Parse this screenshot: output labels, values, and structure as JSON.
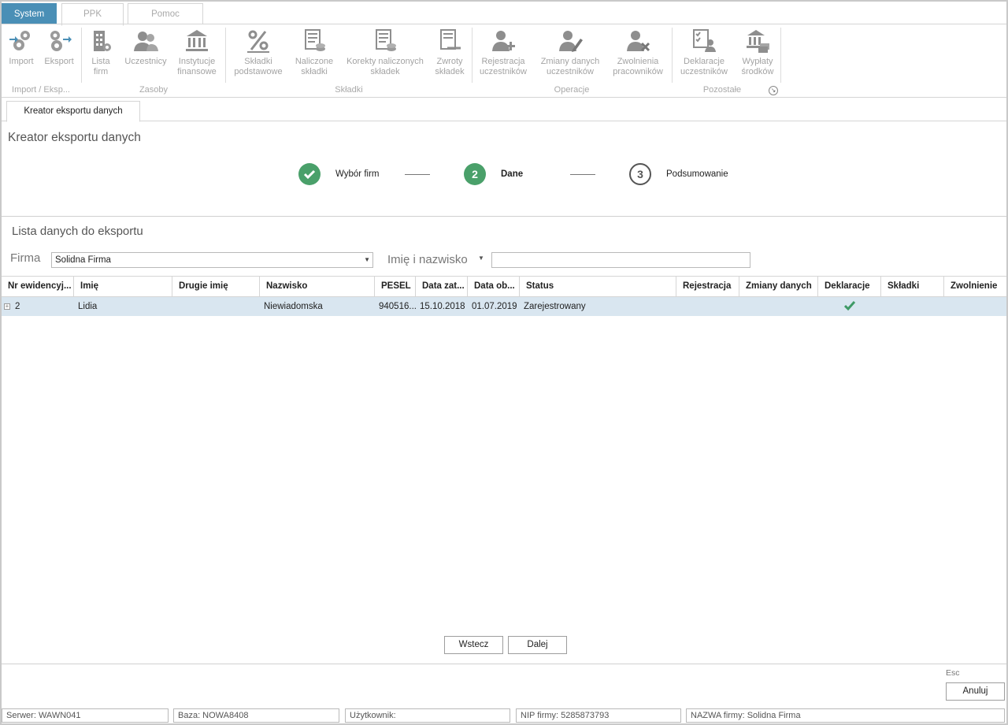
{
  "ribbon": {
    "tabs": [
      "System",
      "PPK",
      "Pomoc"
    ],
    "buttons": {
      "import": "Import",
      "eksport": "Eksport",
      "lista_firm": [
        "Lista",
        "firm"
      ],
      "uczestnicy": "Uczestnicy",
      "instytucje": [
        "Instytucje",
        "finansowe"
      ],
      "skladki_podstawowe": [
        "Składki",
        "podstawowe"
      ],
      "naliczone": [
        "Naliczone",
        "składki"
      ],
      "korekty": [
        "Korekty naliczonych",
        "składek"
      ],
      "zwroty": [
        "Zwroty",
        "składek"
      ],
      "rejestracja": [
        "Rejestracja",
        "uczestników"
      ],
      "zmiany": [
        "Zmiany danych",
        "uczestników"
      ],
      "zwolnienia": [
        "Zwolnienia",
        "pracowników"
      ],
      "deklaracje": [
        "Deklaracje",
        "uczestników"
      ],
      "wyplaty": [
        "Wypłaty",
        "środków"
      ]
    },
    "groups": {
      "import_eksport": "Import / Eksp...",
      "zasoby": "Zasoby",
      "skladki": "Składki",
      "operacje": "Operacje",
      "pozostale": "Pozostałe"
    }
  },
  "document_tab": "Kreator eksportu danych",
  "wizard": {
    "title": "Kreator eksportu danych",
    "steps": [
      {
        "number": "",
        "label": "Wybór firm",
        "state": "done"
      },
      {
        "number": "2",
        "label": "Dane",
        "state": "active"
      },
      {
        "number": "3",
        "label": "Podsumowanie",
        "state": "pending"
      }
    ]
  },
  "list": {
    "title": "Lista danych do eksportu",
    "firma_label": "Firma",
    "firma_value": "Solidna Firma",
    "name_filter_label": "Imię i nazwisko",
    "name_filter_value": ""
  },
  "grid": {
    "columns": [
      "Nr ewidencyj...",
      "Imię",
      "Drugie imię",
      "Nazwisko",
      "PESEL",
      "Data zat...",
      "Data ob...",
      "Status",
      "Rejestracja",
      "Zmiany danych",
      "Deklaracje",
      "Składki",
      "Zwolnienie"
    ],
    "rows": [
      {
        "nr": "2",
        "imie": "Lidia",
        "drugie_imie": "",
        "nazwisko": "Niewiadomska",
        "pesel": "940516...",
        "data_zat": "15.10.2018",
        "data_ob": "01.07.2019",
        "status": "Zarejestrowany",
        "rejestracja": "",
        "zmiany_danych": "",
        "deklaracje": true,
        "skladki": "",
        "zwolnienie": ""
      }
    ]
  },
  "buttons": {
    "back": "Wstecz",
    "next": "Dalej",
    "cancel": "Anuluj",
    "esc_hint": "Esc"
  },
  "statusbar": {
    "server": "Serwer: WAWN041",
    "database": "Baza: NOWA8408",
    "user": "Użytkownik:",
    "nip": "NIP firmy: 5285873793",
    "company": "NAZWA firmy: Solidna Firma"
  },
  "colors": {
    "system_tab": "#4a8fb6",
    "step_green": "#4aa06a",
    "selected_row": "#d9e6f0"
  }
}
